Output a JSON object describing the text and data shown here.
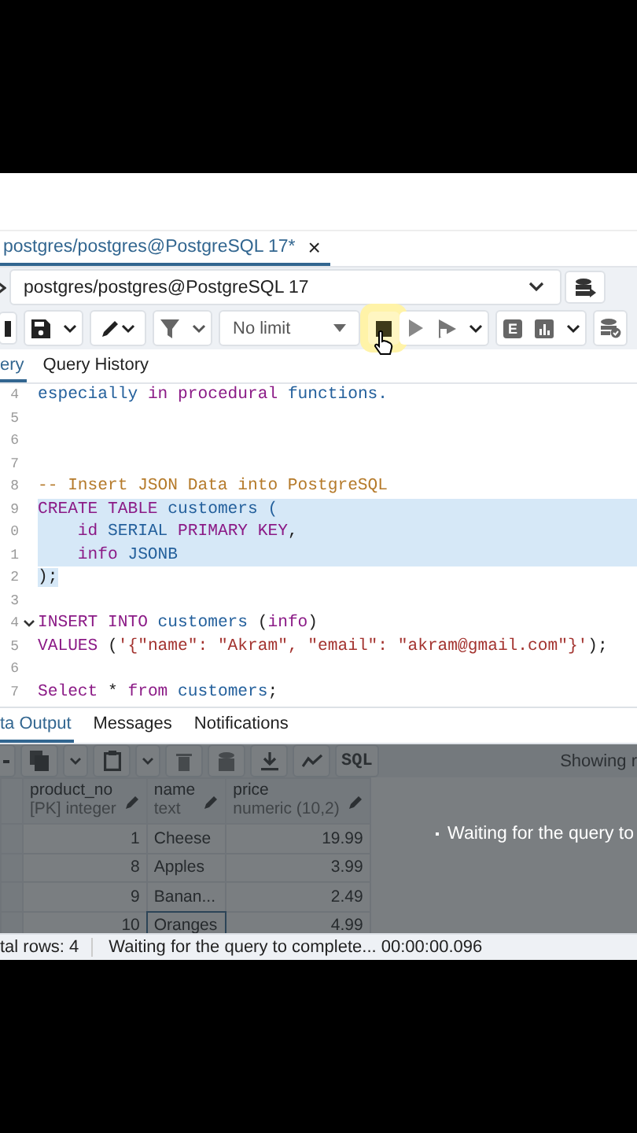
{
  "query_tab": {
    "title": "postgres/postgres@PostgreSQL 17*",
    "close": "×"
  },
  "connection": {
    "value": "postgres/postgres@PostgreSQL 17"
  },
  "toolbar": {
    "limit": "No limit",
    "explain_label": "E",
    "stop_pressed": true
  },
  "editor_tabs": [
    {
      "label": "ery",
      "selected": true
    },
    {
      "label": "Query History",
      "selected": false
    }
  ],
  "editor_lines": [
    {
      "number": "4",
      "selected": false,
      "fold": false,
      "tokens": [
        {
          "text": "especially ",
          "kind": "ident"
        },
        {
          "text": "in procedural ",
          "kind": "keyword"
        },
        {
          "text": "functions.",
          "kind": "ident"
        }
      ]
    },
    {
      "number": "5",
      "selected": false,
      "fold": false
    },
    {
      "number": "6",
      "selected": false,
      "fold": false
    },
    {
      "number": "7",
      "selected": false,
      "fold": false
    },
    {
      "number": "8",
      "selected": false,
      "fold": false,
      "tokens": [
        {
          "text": "-- Insert JSON Data into PostgreSQL",
          "kind": "comment"
        }
      ]
    },
    {
      "number": "9",
      "selected": true,
      "fold": false,
      "tokens": [
        {
          "text": "CREATE TABLE ",
          "kind": "keyword"
        },
        {
          "text": "customers (",
          "kind": "ident"
        }
      ]
    },
    {
      "number": "0",
      "selected": true,
      "fold": false,
      "tokens": [
        {
          "text": "    id ",
          "kind": "keyword"
        },
        {
          "text": "SERIAL ",
          "kind": "ident"
        },
        {
          "text": "PRIMARY KEY",
          "kind": "keyword"
        },
        {
          "text": ",",
          "kind": "punct"
        }
      ]
    },
    {
      "number": "1",
      "selected": true,
      "fold": false,
      "tokens": [
        {
          "text": "    info ",
          "kind": "keyword"
        },
        {
          "text": "JSONB",
          "kind": "ident"
        }
      ]
    },
    {
      "number": "2",
      "selected": true,
      "fold": false,
      "tokens": [
        {
          "text": ");",
          "kind": "punct"
        }
      ]
    },
    {
      "number": "3",
      "selected": false,
      "fold": false
    },
    {
      "number": "4",
      "selected": false,
      "fold": true,
      "tokens": [
        {
          "text": "INSERT INTO ",
          "kind": "keyword"
        },
        {
          "text": "customers ",
          "kind": "ident"
        },
        {
          "text": "(",
          "kind": "punct"
        },
        {
          "text": "info",
          "kind": "keyword"
        },
        {
          "text": ")",
          "kind": "punct"
        }
      ]
    },
    {
      "number": "5",
      "selected": false,
      "fold": false,
      "tokens": [
        {
          "text": "VALUES ",
          "kind": "keyword"
        },
        {
          "text": "(",
          "kind": "punct"
        },
        {
          "text": "'{\"name\": \"Akram\", \"email\": \"akram@gmail.com\"}'",
          "kind": "string"
        },
        {
          "text": ");",
          "kind": "punct"
        }
      ]
    },
    {
      "number": "6",
      "selected": false,
      "fold": false
    },
    {
      "number": "7",
      "selected": false,
      "fold": false,
      "tokens": [
        {
          "text": "Select ",
          "kind": "keyword"
        },
        {
          "text": "* ",
          "kind": "punct"
        },
        {
          "text": "from ",
          "kind": "keyword"
        },
        {
          "text": "customers",
          "kind": "ident"
        },
        {
          "text": ";",
          "kind": "punct"
        }
      ]
    }
  ],
  "result_tabs": [
    {
      "label": "ta Output",
      "selected": true
    },
    {
      "label": "Messages",
      "selected": false
    },
    {
      "label": "Notifications",
      "selected": false
    }
  ],
  "results_toolbar": {
    "sql": "SQL",
    "showing": "Showing r"
  },
  "grid": {
    "columns": [
      {
        "name": "product_no",
        "type": "[PK] integer",
        "kind": "number"
      },
      {
        "name": "name",
        "type": "text",
        "kind": "text"
      },
      {
        "name": "price",
        "type": "numeric (10,2)",
        "kind": "number"
      }
    ],
    "rows": [
      {
        "cells": [
          {
            "text": "1",
            "selected": false
          },
          {
            "text": "Cheese",
            "selected": false
          },
          {
            "text": "19.99",
            "selected": false
          }
        ]
      },
      {
        "cells": [
          {
            "text": "8",
            "selected": false
          },
          {
            "text": "Apples",
            "selected": false
          },
          {
            "text": "3.99",
            "selected": false
          }
        ]
      },
      {
        "cells": [
          {
            "text": "9",
            "selected": false
          },
          {
            "text": "Banan...",
            "selected": false
          },
          {
            "text": "2.49",
            "selected": false
          }
        ]
      },
      {
        "cells": [
          {
            "text": "10",
            "selected": false
          },
          {
            "text": "Oranges",
            "selected": true
          },
          {
            "text": "4.99",
            "selected": false
          }
        ]
      }
    ]
  },
  "loading": {
    "active": true,
    "message": "Waiting for the query to"
  },
  "status_bar": {
    "total": "tal rows: 4",
    "message": "Waiting for the query to complete... 00:00:00.096"
  }
}
